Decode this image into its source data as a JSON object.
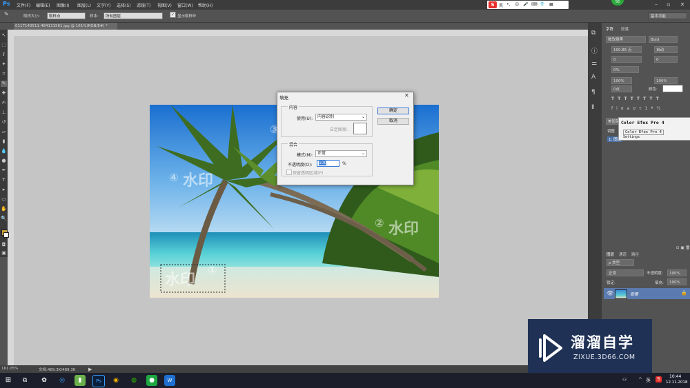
{
  "app": {
    "logo": "Ps",
    "accent": "#35a0ff"
  },
  "menu": [
    "文件(F)",
    "编辑(E)",
    "图像(I)",
    "图层(L)",
    "文字(Y)",
    "选择(S)",
    "滤镜(T)",
    "视图(V)",
    "窗口(W)",
    "帮助(H)"
  ],
  "ime": {
    "logo": "S",
    "lang": "英"
  },
  "badge": "56",
  "options": {
    "sample_size_label": "取样大小:",
    "sample_size_value": "取样点",
    "sample_label": "样本:",
    "sample_value": "所有图层",
    "show_ring_label": "显示取样环",
    "workspace": "基本功能"
  },
  "doc": {
    "tab": "0117140511-484131561.jpg @ 161%(RGB/8#) *"
  },
  "status": {
    "zoom": "161.05%",
    "doc_size": "文档:489.3K/489.3K"
  },
  "dialog": {
    "title": "填充",
    "content_group": "内容",
    "use_label": "使用(U):",
    "use_value": "内容识别",
    "custom_pattern_label": "自定图案:",
    "blend_group": "混合",
    "mode_label": "模式(M):",
    "mode_value": "正常",
    "opacity_label": "不透明度(O):",
    "opacity_value": "100",
    "opacity_unit": "%",
    "preserve_label": "保留透明区域(P)",
    "ok": "确定",
    "cancel": "取消"
  },
  "image": {
    "wm1": "水印",
    "n1": "①",
    "wm2": "水印",
    "n2": "②",
    "n3": "③",
    "wm4": "水印",
    "n4": "④"
  },
  "char_panel": {
    "tab1": "字符",
    "tab2": "段落",
    "font_family": "微软雅黑",
    "font_style": "Bold",
    "size": "100.85 点",
    "leading": "自动",
    "kern": "0",
    "tracking": "0",
    "scale": "0%",
    "vscale": "100%",
    "hscale": "100%",
    "baseline": "0点",
    "color_label": "颜色:",
    "lang": "美国英语"
  },
  "color_efex": {
    "title": "Color Efex Pro 4",
    "item": "Color Efex Pro 4",
    "settings": "Settings"
  },
  "layers": {
    "tabs": [
      "图层",
      "通道",
      "路径"
    ],
    "kind": "ρ 类型",
    "mode": "正常",
    "opacity_label": "不透明度:",
    "opacity": "100%",
    "lock_label": "锁定:",
    "fill_label": "填充:",
    "fill": "100%",
    "layer_name": "背景"
  },
  "side_labels": {
    "l1": "调整",
    "l2": "样式",
    "l3": "1: 图层"
  },
  "taskbar": {
    "lang": "英",
    "time": "10:44",
    "date": "12.11.2018"
  },
  "brand": {
    "name": "溜溜自学",
    "url": "ZIXUE.3D66.COM"
  }
}
